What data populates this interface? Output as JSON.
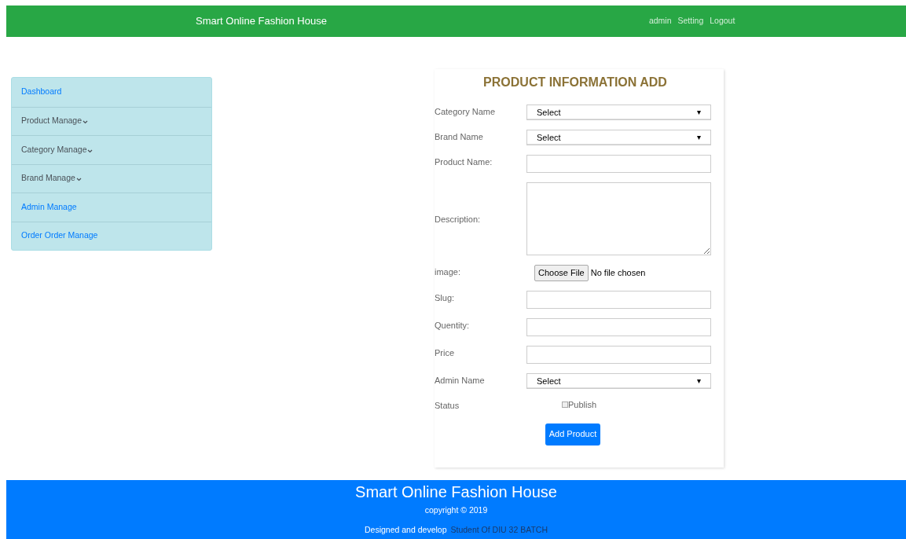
{
  "navbar": {
    "brand": "Smart Online Fashion House",
    "links": [
      "admin",
      "Setting",
      "Logout"
    ]
  },
  "sidebar": {
    "items": [
      {
        "label": "Dashboard",
        "kind": "link"
      },
      {
        "label": "Product Manage",
        "kind": "dropdown"
      },
      {
        "label": "Category Manage",
        "kind": "dropdown"
      },
      {
        "label": "Brand Manage",
        "kind": "dropdown"
      },
      {
        "label": "Admin Manage",
        "kind": "link"
      },
      {
        "label": "Order Order Manage",
        "kind": "link"
      }
    ]
  },
  "form": {
    "title": "PRODUCT INFORMATION ADD",
    "fields": [
      {
        "label": "Category Name",
        "kind": "select",
        "value": "Select"
      },
      {
        "label": "Brand Name",
        "kind": "select",
        "value": "Select"
      },
      {
        "label": "Product Name:",
        "kind": "text"
      },
      {
        "label": "Description:",
        "kind": "textarea"
      },
      {
        "label": "image:",
        "kind": "file",
        "button": "Choose File",
        "value": "No file chosen"
      },
      {
        "label": "Slug:",
        "kind": "text"
      },
      {
        "label": "Quentity:",
        "kind": "text"
      },
      {
        "label": "Price",
        "kind": "text"
      },
      {
        "label": "Admin Name",
        "kind": "select",
        "value": "Select"
      },
      {
        "label": "Status",
        "kind": "checkbox",
        "option": "Publish",
        "checked": false
      }
    ],
    "submit": "Add Product"
  },
  "footer": {
    "title": "Smart Online Fashion House",
    "copyright": "copyright © 2019",
    "credit": "Designed and develop",
    "author": "Student Of DIU 32 BATCH"
  }
}
